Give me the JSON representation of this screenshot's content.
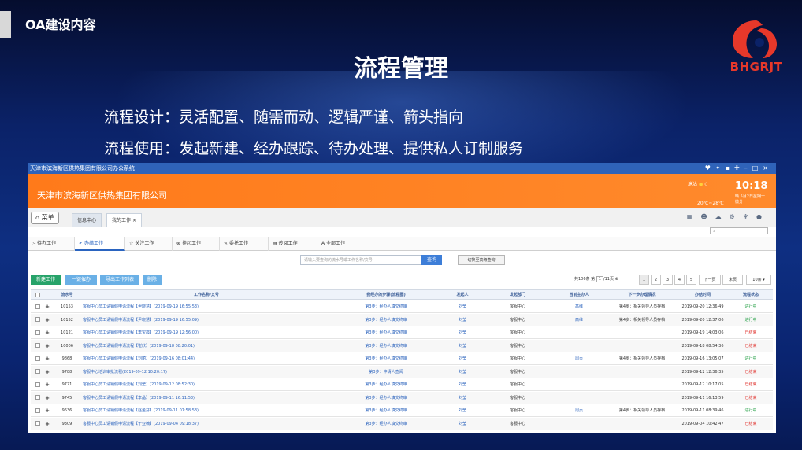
{
  "slide": {
    "header_title": "OA建设内容",
    "main_title": "流程管理",
    "bullets": [
      "流程设计：灵活配置、随需而动、逻辑严谨、箭头指向",
      "流程使用：发起新建、经办跟踪、待办处理、提供私人订制服务"
    ],
    "logo_text": "BHGRJT",
    "colors": {
      "background": "#0b2268",
      "logo": "#e7382a",
      "banner": "#ff7a1a"
    }
  },
  "app": {
    "window_title": "天津市滨海新区供热集团有限公司办公系统",
    "company": "天津市滨海新区供热集团有限公司",
    "weather": {
      "city": "塘沽",
      "temp": "20℃~28℃",
      "wind": "微分",
      "cond": "晴"
    },
    "clock": {
      "time": "10:18",
      "date": "5月2日星期一"
    },
    "home_label": "菜单",
    "nav_tabs": [
      {
        "label": "信息中心",
        "active": false
      },
      {
        "label": "我的工作",
        "active": true,
        "close": "×"
      }
    ],
    "work_tabs": [
      {
        "label": "待办工作",
        "icon": "clock-icon"
      },
      {
        "label": "办结工作",
        "icon": "check-icon",
        "active": true
      },
      {
        "label": "关注工作",
        "icon": "star-icon"
      },
      {
        "label": "挂起工作",
        "icon": "pause-icon"
      },
      {
        "label": "委托工作",
        "icon": "pen-icon"
      },
      {
        "label": "传阅工作",
        "icon": "doc-icon"
      },
      {
        "label": "全部工作",
        "icon": "all-icon"
      }
    ],
    "query_placeholder": "请输入要查询的流水号或工作名称/文号",
    "query_label": "查询",
    "advanced_label": "切换至高级查询",
    "actions": {
      "new": "新建工作",
      "assign": "一键催办",
      "export": "导出工作列表",
      "delete": "删除"
    },
    "pager": {
      "summary": "共106条",
      "page_prefix": "第",
      "page_value": "1",
      "page_suffix": "/11页",
      "pages": [
        "1",
        "2",
        "3",
        "4",
        "5"
      ],
      "next": "下一页",
      "last": "末页",
      "per_page": "10条 ▾"
    },
    "columns": [
      "流水号",
      "工作名称/文号",
      "我经办的步骤(流程图)",
      "发起人",
      "发起部门",
      "当前主办人",
      "下一步办理情况",
      "办结时间",
      "流程状态"
    ],
    "rows": [
      {
        "id": "10153",
        "name": "客服中心员工请销假申请流程【尹晓慧】(2019-09-19 16:55:53)",
        "step": "第3步：经办人填交终审",
        "initiator": "刘莹",
        "dept": "客服中心",
        "handler": "高维",
        "next": "第4步：相关领导人员存档",
        "time": "2019-09-20 12:36:49",
        "status": "进行中"
      },
      {
        "id": "10152",
        "name": "客服中心员工请销假申请流程【尹晓慧】(2019-09-19 16:55:09)",
        "step": "第3步：经办人填交终审",
        "initiator": "刘莹",
        "dept": "客服中心",
        "handler": "高维",
        "next": "第4步：相关领导人员存档",
        "time": "2019-09-20 12:37:06",
        "status": "进行中"
      },
      {
        "id": "10121",
        "name": "客服中心员工请销假申请流程【李宝霞】(2019-09-19 12:56:00)",
        "step": "第3步：经办人填交终审",
        "initiator": "刘莹",
        "dept": "客服中心",
        "handler": "",
        "next": "",
        "time": "2019-09-19 14:03:06",
        "status": "已结束"
      },
      {
        "id": "10006",
        "name": "客服中心员工请销假申请流程【崔欣】(2019-09-18 08:20:01)",
        "step": "第3步：经办人填交终审",
        "initiator": "刘莹",
        "dept": "客服中心",
        "handler": "",
        "next": "",
        "time": "2019-09-18 08:54:36",
        "status": "已结束"
      },
      {
        "id": "9868",
        "name": "客服中心员工请销假申请流程【刘丽】(2019-09-16 08:01:44)",
        "step": "第3步：经办人填交终审",
        "initiator": "刘莹",
        "dept": "客服中心",
        "handler": "周页",
        "next": "第4步：相关领导人员存档",
        "time": "2019-09-16 13:05:07",
        "status": "进行中"
      },
      {
        "id": "9788",
        "name": "客服中心培训审批流程(2019-09-12 10:20:17)",
        "step": "第3步：申请人查阅",
        "initiator": "刘莹",
        "dept": "客服中心",
        "handler": "",
        "next": "",
        "time": "2019-09-12 12:36:35",
        "status": "已结束"
      },
      {
        "id": "9771",
        "name": "客服中心员工请销假申请流程【刘莹】(2019-09-12 08:52:30)",
        "step": "第3步：经办人填交终审",
        "initiator": "刘莹",
        "dept": "客服中心",
        "handler": "",
        "next": "",
        "time": "2019-09-12 10:17:05",
        "status": "已结束"
      },
      {
        "id": "9745",
        "name": "客服中心员工请销假申请流程【李晶】(2019-09-11 16:11:53)",
        "step": "第3步：经办人填交终审",
        "initiator": "刘莹",
        "dept": "客服中心",
        "handler": "",
        "next": "",
        "time": "2019-09-11 16:13:59",
        "status": "已结束"
      },
      {
        "id": "9636",
        "name": "客服中心员工请销假申请流程【赵金芬】(2019-09-11 07:58:53)",
        "step": "第3步：经办人填交终审",
        "initiator": "刘莹",
        "dept": "客服中心",
        "handler": "周页",
        "next": "第4步：相关领导人员存档",
        "time": "2019-09-11 08:39:46",
        "status": "进行中"
      },
      {
        "id": "9309",
        "name": "客服中心员工请销假申请流程【于亚楠】(2019-09-04 09:18:37)",
        "step": "第3步：经办人填交终审",
        "initiator": "刘莹",
        "dept": "客服中心",
        "handler": "",
        "next": "",
        "time": "2019-09-04 10:42:47",
        "status": "已结束"
      }
    ]
  }
}
